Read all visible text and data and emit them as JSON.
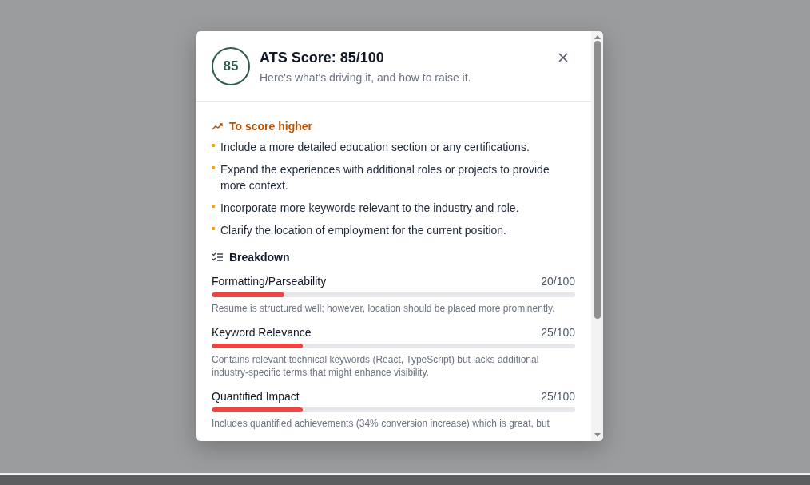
{
  "dialog": {
    "score": "85",
    "title": "ATS Score: 85/100",
    "subtitle": "Here's what's driving it, and how to raise it.",
    "tips_heading": "To score higher",
    "tips": [
      "Include a more detailed education section or any certifications.",
      "Expand the experiences with additional roles or projects to provide more context.",
      "Incorporate more keywords relevant to the industry and role.",
      "Clarify the location of employment for the current position."
    ],
    "breakdown_heading": "Breakdown",
    "breakdown": [
      {
        "name": "Formatting/Parseability",
        "score": "20/100",
        "level": 0.2,
        "note": "Resume is structured well; however, location should be placed more prominently."
      },
      {
        "name": "Keyword Relevance",
        "score": "25/100",
        "level": 0.25,
        "note": "Contains relevant technical keywords (React, TypeScript) but lacks additional industry-specific terms that might enhance visibility."
      },
      {
        "name": "Quantified Impact",
        "score": "25/100",
        "level": 0.25,
        "note": "Includes quantified achievements (34% conversion increase) which is great, but"
      }
    ]
  }
}
